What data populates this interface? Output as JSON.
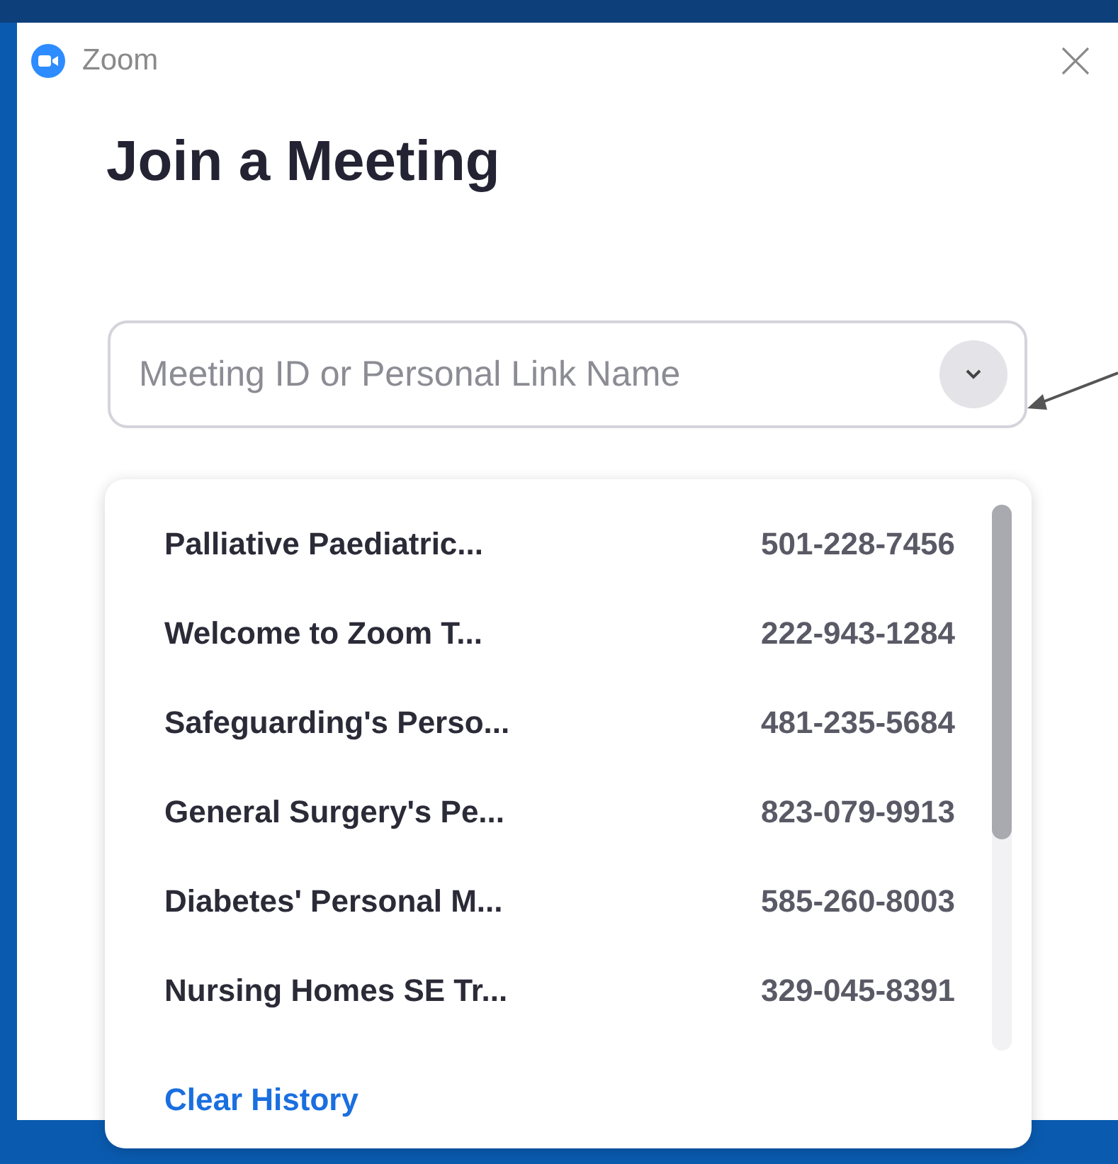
{
  "window": {
    "title": "Zoom"
  },
  "heading": "Join a Meeting",
  "meeting_field": {
    "placeholder": "Meeting ID or Personal Link Name"
  },
  "history": [
    {
      "name": "Palliative Paediatric...",
      "number": "501-228-7456"
    },
    {
      "name": "Welcome to Zoom T...",
      "number": "222-943-1284"
    },
    {
      "name": "Safeguarding's Perso...",
      "number": "481-235-5684"
    },
    {
      "name": "General Surgery's Pe...",
      "number": "823-079-9913"
    },
    {
      "name": "Diabetes' Personal M...",
      "number": "585-260-8003"
    },
    {
      "name": "Nursing Homes SE Tr...",
      "number": "329-045-8391"
    }
  ],
  "clear_history": "Clear History"
}
